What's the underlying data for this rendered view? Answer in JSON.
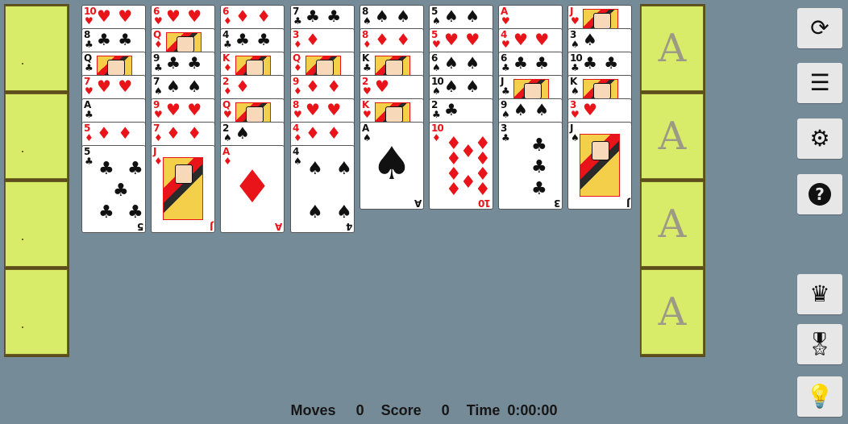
{
  "colors": {
    "table": "#768b98",
    "slot": "#d8ec6a",
    "slot_border": "#6f6324",
    "red": "#e8141a",
    "black": "#111111"
  },
  "free_cells": [
    {
      "name": "free-cell-1"
    },
    {
      "name": "free-cell-2"
    },
    {
      "name": "free-cell-3"
    },
    {
      "name": "free-cell-4"
    }
  ],
  "foundations": [
    {
      "label": "A"
    },
    {
      "label": "A"
    },
    {
      "label": "A"
    },
    {
      "label": "A"
    }
  ],
  "tableau": [
    [
      {
        "rank": "10",
        "suit": "♥"
      },
      {
        "rank": "8",
        "suit": "♣"
      },
      {
        "rank": "Q",
        "suit": "♣"
      },
      {
        "rank": "7",
        "suit": "♥"
      },
      {
        "rank": "A",
        "suit": "♣"
      },
      {
        "rank": "5",
        "suit": "♦"
      },
      {
        "rank": "5",
        "suit": "♣"
      }
    ],
    [
      {
        "rank": "6",
        "suit": "♥"
      },
      {
        "rank": "Q",
        "suit": "♦"
      },
      {
        "rank": "9",
        "suit": "♣"
      },
      {
        "rank": "7",
        "suit": "♠"
      },
      {
        "rank": "9",
        "suit": "♥"
      },
      {
        "rank": "7",
        "suit": "♦"
      },
      {
        "rank": "J",
        "suit": "♦"
      }
    ],
    [
      {
        "rank": "6",
        "suit": "♦"
      },
      {
        "rank": "4",
        "suit": "♣"
      },
      {
        "rank": "K",
        "suit": "♦"
      },
      {
        "rank": "2",
        "suit": "♦"
      },
      {
        "rank": "Q",
        "suit": "♥"
      },
      {
        "rank": "2",
        "suit": "♠"
      },
      {
        "rank": "A",
        "suit": "♦"
      }
    ],
    [
      {
        "rank": "7",
        "suit": "♣"
      },
      {
        "rank": "3",
        "suit": "♦"
      },
      {
        "rank": "Q",
        "suit": "♦"
      },
      {
        "rank": "9",
        "suit": "♦"
      },
      {
        "rank": "8",
        "suit": "♥"
      },
      {
        "rank": "4",
        "suit": "♦"
      },
      {
        "rank": "4",
        "suit": "♠"
      }
    ],
    [
      {
        "rank": "8",
        "suit": "♠"
      },
      {
        "rank": "8",
        "suit": "♦"
      },
      {
        "rank": "K",
        "suit": "♣"
      },
      {
        "rank": "2",
        "suit": "♥"
      },
      {
        "rank": "K",
        "suit": "♥"
      },
      {
        "rank": "A",
        "suit": "♠"
      }
    ],
    [
      {
        "rank": "5",
        "suit": "♠"
      },
      {
        "rank": "5",
        "suit": "♥"
      },
      {
        "rank": "6",
        "suit": "♠"
      },
      {
        "rank": "10",
        "suit": "♠"
      },
      {
        "rank": "2",
        "suit": "♣"
      },
      {
        "rank": "10",
        "suit": "♦"
      }
    ],
    [
      {
        "rank": "A",
        "suit": "♥"
      },
      {
        "rank": "4",
        "suit": "♥"
      },
      {
        "rank": "6",
        "suit": "♣"
      },
      {
        "rank": "J",
        "suit": "♣"
      },
      {
        "rank": "9",
        "suit": "♠"
      },
      {
        "rank": "3",
        "suit": "♣"
      }
    ],
    [
      {
        "rank": "J",
        "suit": "♥"
      },
      {
        "rank": "3",
        "suit": "♠"
      },
      {
        "rank": "10",
        "suit": "♣"
      },
      {
        "rank": "K",
        "suit": "♠"
      },
      {
        "rank": "3",
        "suit": "♥"
      },
      {
        "rank": "J",
        "suit": "♠"
      }
    ]
  ],
  "toolbar": [
    {
      "name": "restart-button",
      "icon": "refresh-icon",
      "glyph": "⟳"
    },
    {
      "name": "menu-button",
      "icon": "hamburger-menu-icon",
      "glyph": "☰"
    },
    {
      "name": "settings-button",
      "icon": "gear-icon",
      "glyph": "⚙"
    },
    {
      "name": "help-button",
      "icon": "question-circle-icon",
      "glyph": "?"
    },
    {
      "name": "leaderboard-button",
      "icon": "crown-icon",
      "glyph": "♛"
    },
    {
      "name": "achievements-button",
      "icon": "award-ribbon-icon",
      "glyph": "🎖"
    },
    {
      "name": "hint-button",
      "icon": "lightbulb-icon",
      "glyph": "💡"
    }
  ],
  "status": {
    "moves_label": "Moves",
    "moves": "0",
    "score_label": "Score",
    "score": "0",
    "time_label": "Time",
    "time": "0:00:00"
  }
}
